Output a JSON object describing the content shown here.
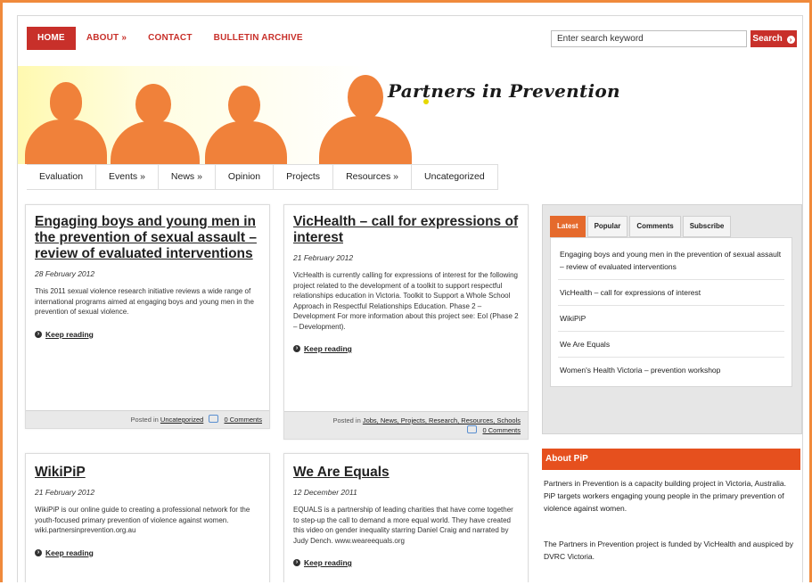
{
  "topnav": {
    "items": [
      "HOME",
      "ABOUT »",
      "CONTACT",
      "BULLETIN ARCHIVE"
    ],
    "search_value": "Enter search keyword",
    "search_button": "Search"
  },
  "site": {
    "title": "Partners in Prevention"
  },
  "subnav": {
    "items": [
      "Evaluation",
      "Events »",
      "News »",
      "Opinion",
      "Projects",
      "Resources »",
      "Uncategorized"
    ]
  },
  "posts": [
    {
      "title": "Engaging boys and young men in the prevention of sexual assault – review of evaluated interventions",
      "date": "28 February 2012",
      "excerpt": "This 2011 sexual violence research initiative reviews a wide range of international programs aimed at engaging boys and young men in the prevention of sexual violence.",
      "more": "Keep reading",
      "posted_in": "Posted in",
      "categories": "Uncategorized",
      "comments": "0 Comments"
    },
    {
      "title": "VicHealth – call for expressions of interest",
      "date": "21 February 2012",
      "excerpt": "VicHealth is currently calling for expressions of interest for the following project related to the development of a toolkit to support respectful relationships education in Victoria. Toolkit to Support a Whole School Approach in Respectful Relationships Education. Phase 2 – Development For more information about this project see: EoI (Phase 2 – Development).",
      "more": "Keep reading",
      "posted_in": "Posted in",
      "categories": "Jobs, News, Projects, Research, Resources, Schools",
      "comments": "0 Comments"
    },
    {
      "title": "WikiPiP",
      "date": "21 February 2012",
      "excerpt": "WikiPiP is our online guide to creating a professional network for the youth-focused primary prevention of violence against women. wiki.partnersinprevention.org.au",
      "more": "Keep reading"
    },
    {
      "title": "We Are Equals",
      "date": "12 December 2011",
      "excerpt": "EQUALS is a partnership of leading charities that have come together to step-up the call to demand a more equal world. They have created this video on gender inequality starring Daniel Craig and narrated by Judy Dench. www.weareequals.org",
      "more": "Keep reading"
    }
  ],
  "sidebar": {
    "tabs": [
      "Latest",
      "Popular",
      "Comments",
      "Subscribe"
    ],
    "latest": [
      "Engaging boys and young men in the prevention of sexual assault – review of evaluated interventions",
      "VicHealth – call for expressions of interest",
      "WikiPiP",
      "We Are Equals",
      "Women's Health Victoria – prevention workshop"
    ],
    "about_title": "About PiP",
    "about_p1": "Partners in Prevention is a capacity building project in Victoria, Australia. PiP targets workers engaging young people in the primary prevention of violence against women.",
    "about_p2": "The Partners in Prevention project is funded by VicHealth and auspiced by DVRC Victoria."
  }
}
